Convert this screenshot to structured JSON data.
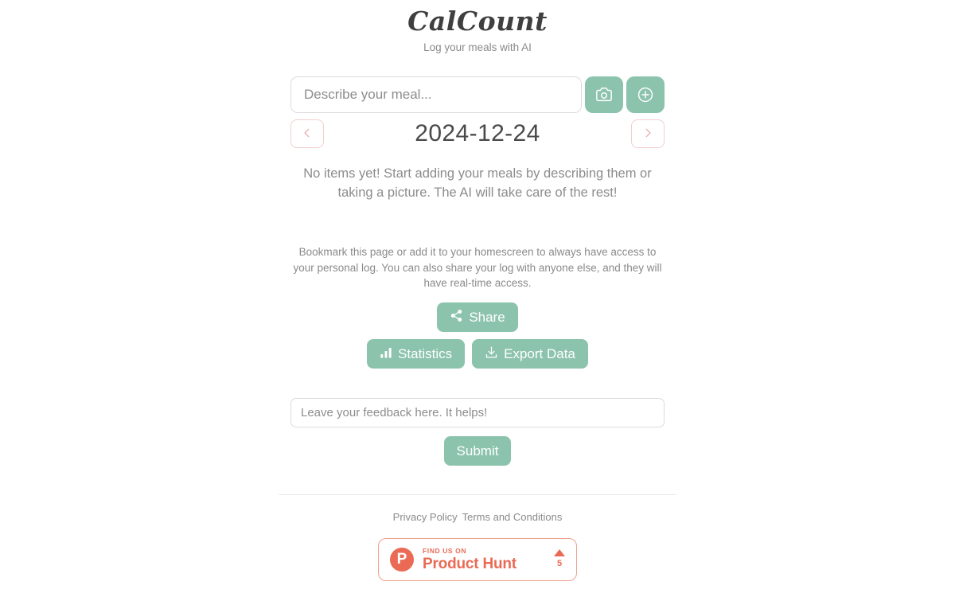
{
  "header": {
    "title": "CalCount",
    "tagline": "Log your meals with AI"
  },
  "entry": {
    "placeholder": "Describe your meal...",
    "value": "",
    "camera_icon": "camera-icon",
    "add_icon": "plus-circle-icon"
  },
  "date_nav": {
    "prev_icon": "chevron-left-icon",
    "next_icon": "chevron-right-icon",
    "current_date": "2024-12-24"
  },
  "empty_state": {
    "message": "No items yet! Start adding your meals by describing them or taking a picture. The AI will take care of the rest!"
  },
  "bookmark": {
    "text": "Bookmark this page or add it to your homescreen to always have access to your personal log. You can also share your log with anyone else, and they will have real-time access."
  },
  "actions": {
    "share_label": "Share",
    "share_icon": "share-icon",
    "statistics_label": "Statistics",
    "statistics_icon": "bar-chart-icon",
    "export_label": "Export Data",
    "export_icon": "download-icon"
  },
  "feedback": {
    "placeholder": "Leave your feedback here. It helps!",
    "value": "",
    "submit_label": "Submit"
  },
  "footer": {
    "privacy_label": "Privacy Policy",
    "terms_label": "Terms and Conditions"
  },
  "product_hunt": {
    "logo_letter": "P",
    "kicker": "FIND US ON",
    "name": "Product Hunt",
    "upvote_icon": "caret-up-icon",
    "upvote_count": "5"
  },
  "colors": {
    "accent_green": "#8cc3ac",
    "accent_coral": "#ea6a55",
    "pink_border": "#f2cfcf",
    "text_muted": "#8a8a8a",
    "text_dark": "#4a4a4a"
  }
}
